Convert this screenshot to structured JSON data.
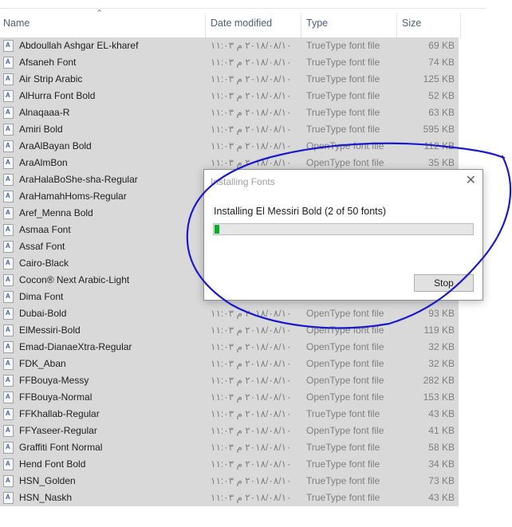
{
  "columns": {
    "name": "Name",
    "date": "Date modified",
    "type": "Type",
    "size": "Size"
  },
  "files": [
    {
      "name": "Abdoullah Ashgar EL-kharef",
      "date": "٢٠١٨/٠٨/١٠ م ١١:٠٣",
      "type": "TrueType font file",
      "size": "69 KB"
    },
    {
      "name": "Afsaneh Font",
      "date": "٢٠١٨/٠٨/١٠ م ١١:٠٣",
      "type": "TrueType font file",
      "size": "74 KB"
    },
    {
      "name": "Air Strip Arabic",
      "date": "٢٠١٨/٠٨/١٠ م ١١:٠٣",
      "type": "TrueType font file",
      "size": "125 KB"
    },
    {
      "name": "AlHurra Font Bold",
      "date": "٢٠١٨/٠٨/١٠ م ١١:٠٣",
      "type": "TrueType font file",
      "size": "52 KB"
    },
    {
      "name": "Alnaqaaa-R",
      "date": "٢٠١٨/٠٨/١٠ م ١١:٠٣",
      "type": "TrueType font file",
      "size": "63 KB"
    },
    {
      "name": "Amiri Bold",
      "date": "٢٠١٨/٠٨/١٠ م ١١:٠٣",
      "type": "TrueType font file",
      "size": "595 KB"
    },
    {
      "name": "AraAlBayan Bold",
      "date": "٢٠١٨/٠٨/١٠ م ١١:٠٣",
      "type": "OpenType font file",
      "size": "112 KB"
    },
    {
      "name": "AraAlmBon",
      "date": "٢٠١٨/٠٨/١٠ م ١١:٠٣",
      "type": "OpenType font file",
      "size": "35 KB"
    },
    {
      "name": "AraHalaBoShe-sha-Regular",
      "date": "",
      "type": "",
      "size": ""
    },
    {
      "name": "AraHamahHoms-Regular",
      "date": "",
      "type": "",
      "size": ""
    },
    {
      "name": "Aref_Menna Bold",
      "date": "",
      "type": "",
      "size": ""
    },
    {
      "name": "Asmaa Font",
      "date": "",
      "type": "",
      "size": ""
    },
    {
      "name": "Assaf Font",
      "date": "",
      "type": "",
      "size": ""
    },
    {
      "name": "Cairo-Black",
      "date": "",
      "type": "",
      "size": ""
    },
    {
      "name": "Cocon® Next Arabic-Light",
      "date": "",
      "type": "",
      "size": ""
    },
    {
      "name": "Dima Font",
      "date": "",
      "type": "",
      "size": ""
    },
    {
      "name": "Dubai-Bold",
      "date": "٢٠١٨/٠٨/١٠ م ١١:٠٣",
      "type": "OpenType font file",
      "size": "93 KB"
    },
    {
      "name": "ElMessiri-Bold",
      "date": "٢٠١٨/٠٨/١٠ م ١١:٠٣",
      "type": "OpenType font file",
      "size": "119 KB"
    },
    {
      "name": "Emad-DianaeXtra-Regular",
      "date": "٢٠١٨/٠٨/١٠ م ١١:٠٣",
      "type": "OpenType font file",
      "size": "32 KB"
    },
    {
      "name": "FDK_Aban",
      "date": "٢٠١٨/٠٨/١٠ م ١١:٠٣",
      "type": "OpenType font file",
      "size": "32 KB"
    },
    {
      "name": "FFBouya-Messy",
      "date": "٢٠١٨/٠٨/١٠ م ١١:٠٣",
      "type": "OpenType font file",
      "size": "282 KB"
    },
    {
      "name": "FFBouya-Normal",
      "date": "٢٠١٨/٠٨/١٠ م ١١:٠٣",
      "type": "OpenType font file",
      "size": "153 KB"
    },
    {
      "name": "FFKhallab-Regular",
      "date": "٢٠١٨/٠٨/١٠ م ١١:٠٣",
      "type": "TrueType font file",
      "size": "43 KB"
    },
    {
      "name": "FFYaseer-Regular",
      "date": "٢٠١٨/٠٨/١٠ م ١١:٠٣",
      "type": "OpenType font file",
      "size": "41 KB"
    },
    {
      "name": "Graffiti Font Normal",
      "date": "٢٠١٨/٠٨/١٠ م ١١:٠٣",
      "type": "TrueType font file",
      "size": "58 KB"
    },
    {
      "name": "Hend Font Bold",
      "date": "٢٠١٨/٠٨/١٠ م ١١:٠٣",
      "type": "TrueType font file",
      "size": "34 KB"
    },
    {
      "name": "HSN_Golden",
      "date": "٢٠١٨/٠٨/١٠ م ١١:٠٣",
      "type": "TrueType font file",
      "size": "73 KB"
    },
    {
      "name": "HSN_Naskh",
      "date": "٢٠١٨/٠٨/١٠ م ١١:٠٣",
      "type": "TrueType font file",
      "size": "43 KB"
    }
  ],
  "dialog": {
    "title": "Installing Fonts",
    "message": "Installing El Messiri Bold (2 of 50 fonts)",
    "progress": 0.02,
    "stop_label": "Stop"
  },
  "colors": {
    "selection": "#d9d9d9",
    "progress_fill": "#06b025",
    "annotation": "#1a1acc"
  },
  "icons": {
    "sort": "sort-up-icon",
    "file": "font-file-icon",
    "close": "close-icon"
  }
}
